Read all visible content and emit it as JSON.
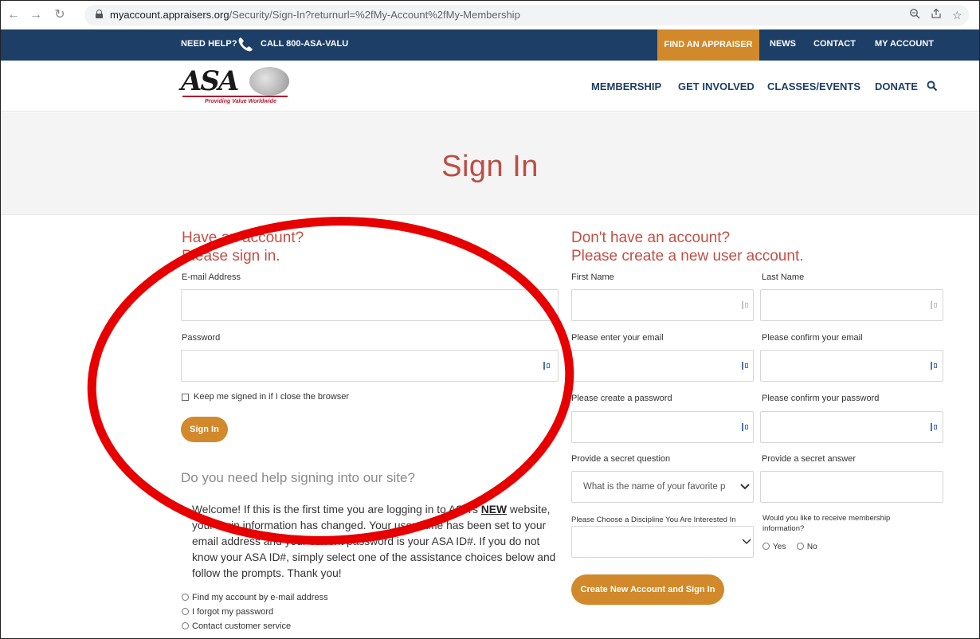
{
  "browser": {
    "url_host": "myaccount.appraisers.org",
    "url_path": "/Security/Sign-In?returnurl=%2fMy-Account%2fMy-Membership",
    "back_icon": "arrow-left-icon",
    "forward_icon": "arrow-right-icon",
    "reload_icon": "reload-icon",
    "lock_icon": "lock-icon",
    "zoom_icon": "zoom-icon",
    "share_icon": "share-icon",
    "star_icon": "star-icon"
  },
  "utility_bar": {
    "help": "NEED HELP?",
    "call": "CALL 800-ASA-VALU",
    "find": "FIND AN APPRAISER",
    "news": "NEWS",
    "contact": "CONTACT",
    "my_account": "MY ACCOUNT",
    "bg_color": "#1d3e66",
    "accent_color": "#d1892b"
  },
  "logo": {
    "text": "ASA",
    "tagline": "Providing Value Worldwide"
  },
  "main_nav": {
    "membership": "MEMBERSHIP",
    "get_involved": "GET INVOLVED",
    "classes_events": "CLASSES/EVENTS",
    "donate": "DONATE"
  },
  "hero": {
    "title": "Sign In",
    "title_color": "#bb4d44"
  },
  "signin": {
    "heading_line1": "Have an account?",
    "heading_line2": "Please sign in.",
    "email_label": "E-mail Address",
    "email_value": "",
    "password_label": "Password",
    "password_value": "",
    "keep_signed": "Keep me signed in if I close the browser",
    "button": "Sign In"
  },
  "help": {
    "heading": "Do you need help signing into our site?",
    "welcome_before": "Welcome! If this is the first time you are logging in to ASA's ",
    "welcome_bold": "NEW",
    "welcome_after": " website, your login information has changed. Your username has been set to your email address and your current password is your ASA ID#. If you do not know your ASA ID#, simply select one of the assistance choices below and follow the prompts.  Thank you!",
    "options": [
      "Find my account by e-mail address",
      "I forgot my password",
      "Contact customer service"
    ]
  },
  "register": {
    "heading_line1": "Don't have an account?",
    "heading_line2": "Please create a new user account.",
    "first_name": "First Name",
    "last_name": "Last Name",
    "email": "Please enter your email",
    "confirm_email": "Please confirm your email",
    "create_password": "Please create a password",
    "confirm_password": "Please confirm your password",
    "secret_question": "Provide a secret question",
    "secret_question_value": "What is the name of your favorite p",
    "secret_answer": "Provide a secret answer",
    "discipline": "Please Choose a Discipline You Are Interested In",
    "discipline_value": "",
    "membership_info": "Would you like to receive membership information?",
    "yes": "Yes",
    "no": "No",
    "button": "Create New Account and Sign In"
  },
  "annotation": {
    "color": "#e60000",
    "icon": "red-ellipse-annotation"
  }
}
